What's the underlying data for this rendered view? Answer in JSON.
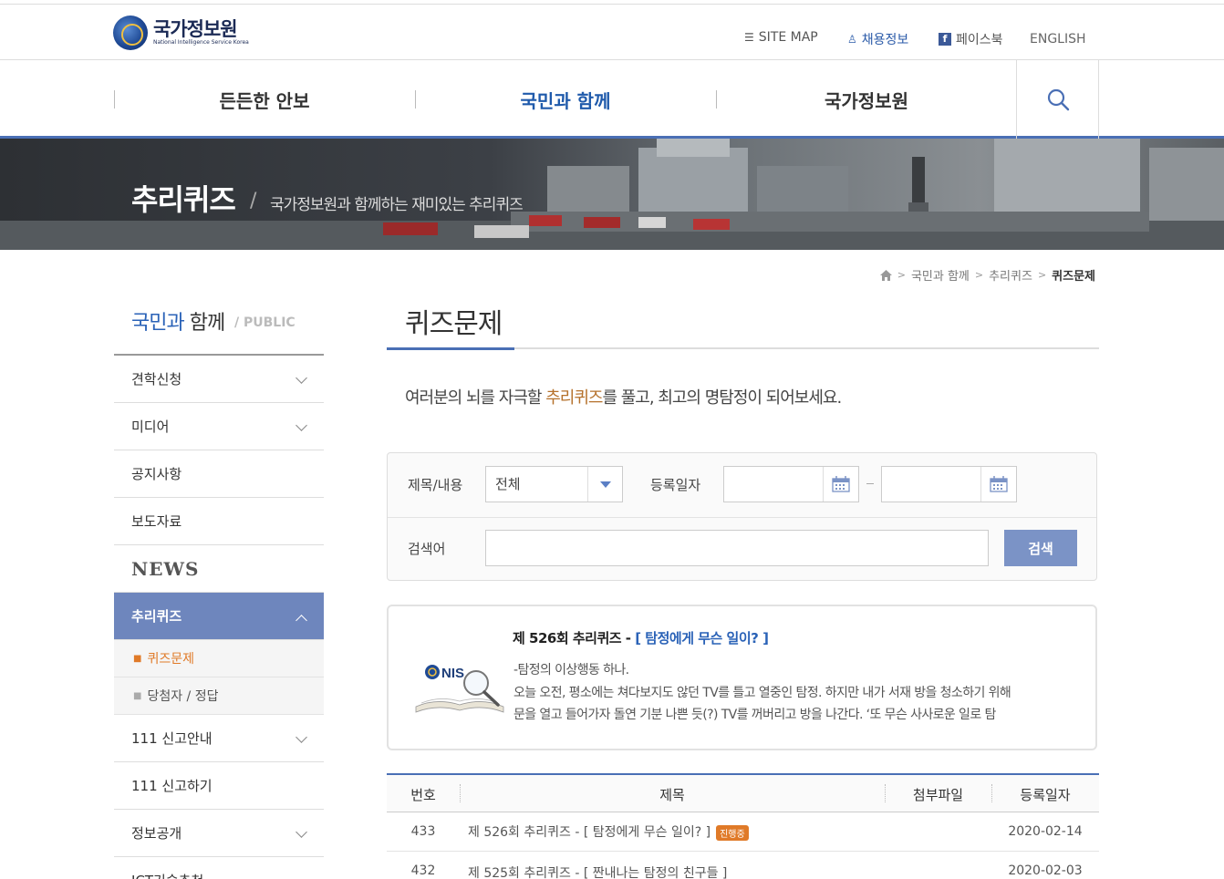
{
  "header": {
    "logo_ko": "국가정보원",
    "logo_en": "National Intelligence Service Korea",
    "util": {
      "sitemap": "SITE MAP",
      "recruit": "채용정보",
      "facebook": "페이스북",
      "english": "ENGLISH"
    }
  },
  "gnb": {
    "items": [
      {
        "label": "든든한 안보",
        "active": false
      },
      {
        "label": "국민과 함께",
        "active": true
      },
      {
        "label": "국가정보원",
        "active": false
      }
    ]
  },
  "hero": {
    "title": "추리퀴즈",
    "slash": "/",
    "subtitle": "국가정보원과 함께하는 재미있는 추리퀴즈"
  },
  "breadcrumb": [
    "국민과 함께",
    "추리퀴즈",
    "퀴즈문제"
  ],
  "sidebar": {
    "title_blue": "국민과",
    "title_gray": " 함께",
    "sub": "/ PUBLIC",
    "items": [
      {
        "label": "견학신청"
      },
      {
        "label": "미디어"
      },
      {
        "label": "공지사항"
      },
      {
        "label": "보도자료"
      },
      {
        "label": "NEWS"
      },
      {
        "label": "추리퀴즈"
      },
      {
        "label": "111 신고안내"
      },
      {
        "label": "111 신고하기"
      },
      {
        "label": "정보공개"
      },
      {
        "label": "ICT기술추천"
      }
    ],
    "sub_items": [
      {
        "label": "퀴즈문제"
      },
      {
        "label": "당첨자 / 정답"
      }
    ]
  },
  "main": {
    "title": "퀴즈문제",
    "intro_before": "여러분의 뇌를 자극할 ",
    "intro_highlight": "추리퀴즈",
    "intro_after": "를 풀고, 최고의 명탐정이 되어보세요."
  },
  "search": {
    "field_label": "제목/내용",
    "field_value": "전체",
    "date_label": "등록일자",
    "keyword_label": "검색어",
    "button": "검색"
  },
  "feature": {
    "head": "제 526회 추리퀴즈 - ",
    "head_link": "[ 탐정에게 무슨 일이? ]",
    "lines": [
      "-탐정의 이상행동 하나.",
      "오늘 오전, 평소에는 쳐다보지도 않던 TV를 틀고 열중인 탐정. 하지만 내가 서재 방을 청소하기 위해",
      "문을 열고 들어가자 돌연 기분 나쁜 듯(?) TV를 꺼버리고 방을 나간다.        ‘또 무슨 사사로운 일로 탐"
    ]
  },
  "table": {
    "headers": [
      "번호",
      "제목",
      "첨부파일",
      "등록일자"
    ],
    "rows": [
      {
        "no": "433",
        "title": "제 526회 추리퀴즈 - [ 탐정에게 무슨 일이? ]",
        "badge": "진행중",
        "date": "2020-02-14"
      },
      {
        "no": "432",
        "title": "제 525회 추리퀴즈 - [ 짠내나는 탐정의 친구들 ]",
        "badge": "",
        "date": "2020-02-03"
      }
    ]
  },
  "colors": {
    "accent": "#4a6fb5",
    "active_menu": "#6e86bd",
    "highlight": "#b5712b",
    "badge": "#e07a28"
  }
}
